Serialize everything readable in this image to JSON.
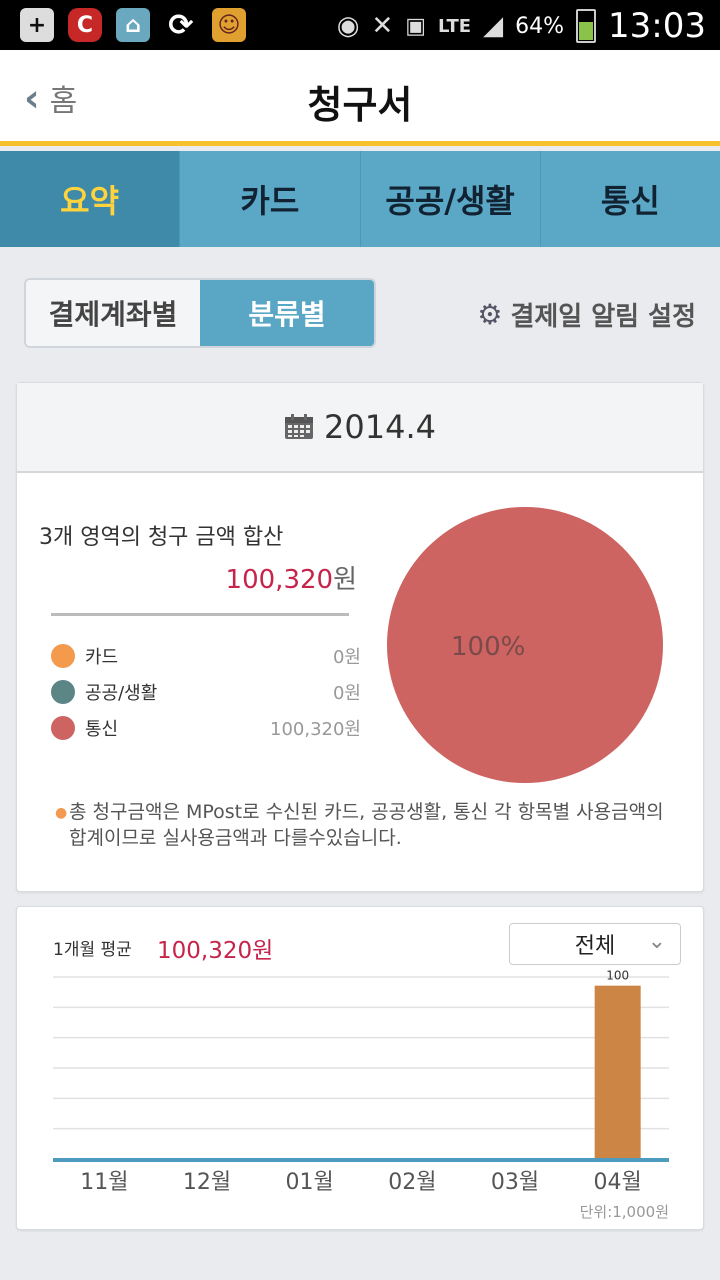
{
  "status": {
    "battery": "64%",
    "time": "13:03",
    "network": "LTE"
  },
  "header": {
    "back_label": "홈",
    "title": "청구서"
  },
  "tabs": [
    {
      "label": "요약",
      "active": true
    },
    {
      "label": "카드",
      "active": false
    },
    {
      "label": "공공/생활",
      "active": false
    },
    {
      "label": "통신",
      "active": false
    }
  ],
  "view_toggle": {
    "by_account": "결제계좌별",
    "by_category": "분류별",
    "selected": "분류별"
  },
  "alarm_settings": "결제일 알림 설정",
  "summary": {
    "date": "2014.4",
    "total_label": "3개 영역의 청구 금액 합산",
    "total_value": "100,320",
    "currency": "원",
    "categories": [
      {
        "name": "카드",
        "amount": "0원",
        "color": "#f39a4c"
      },
      {
        "name": "공공/생활",
        "amount": "0원",
        "color": "#5c8585"
      },
      {
        "name": "통신",
        "amount": "100,320원",
        "color": "#cd6462"
      }
    ],
    "pie_label": "100%",
    "note": "총 청구금액은 MPost로 수신된 카드, 공공생활, 통신 각 항목별 사용금액의 합계이므로 실사용금액과 다를수있습니다."
  },
  "monthly": {
    "avg_label": "1개월 평균",
    "avg_value": "100,320원",
    "filter": "전체",
    "unit_note": "단위:1,000원"
  },
  "chart_data": {
    "type": "bar",
    "categories": [
      "11월",
      "12월",
      "01월",
      "02월",
      "03월",
      "04월"
    ],
    "values": [
      0,
      0,
      0,
      0,
      0,
      100
    ],
    "data_labels": [
      "",
      "",
      "",
      "",
      "",
      "100"
    ],
    "ylim": [
      0,
      105
    ],
    "grid": true,
    "bar_color": "#cd8545",
    "axis_color": "#4d9bbf"
  }
}
